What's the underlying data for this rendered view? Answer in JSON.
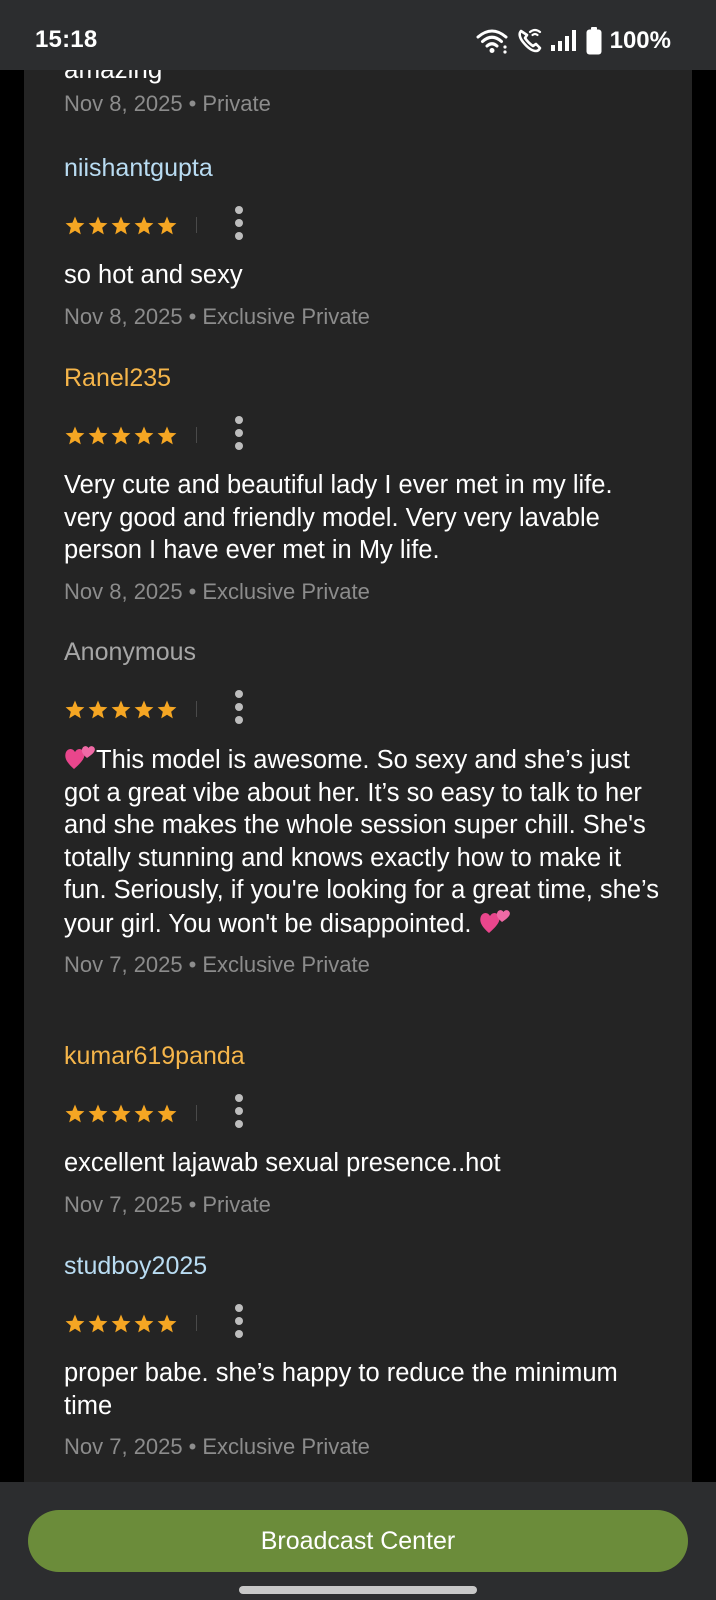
{
  "status_bar": {
    "time": "15:18",
    "battery": "100%"
  },
  "partial_text": "amazing",
  "partial_meta": {
    "date": "Nov 8, 2025",
    "session": "Private"
  },
  "reviews": [
    {
      "username": "niishantgupta",
      "username_color": "#b9dcf2",
      "stars": 5,
      "text": "so hot and sexy",
      "date": "Nov 8, 2025",
      "session": "Exclusive Private"
    },
    {
      "username": "Ranel235",
      "username_color": "#f5b54a",
      "stars": 5,
      "text": "Very cute and beautiful lady I ever met in my life. very good and friendly model. Very very lavable person I have ever met in My life.",
      "date": "Nov 8, 2025",
      "session": "Exclusive Private"
    },
    {
      "username": "Anonymous",
      "username_color": "#a6a6a6",
      "stars": 5,
      "text": "This model is awesome. So sexy and she’s just got a great vibe about her. It’s so easy to talk to her and she makes the whole session super chill. She's totally stunning and knows exactly how to make it fun. Seriously, if you're looking for a great time, she’s your girl. You won't be disappointed.",
      "emoji": "two-hearts-icon",
      "date": "Nov 7, 2025",
      "session": "Exclusive Private"
    },
    {
      "username": "kumar619panda",
      "username_color": "#f5b54a",
      "stars": 5,
      "text": "excellent lajawab sexual presence..hot",
      "date": "Nov 7, 2025",
      "session": "Private"
    },
    {
      "username": "studboy2025",
      "username_color": "#b9dcf2",
      "stars": 5,
      "text": "proper babe. she’s happy to reduce the minimum time",
      "date": "Nov 7, 2025",
      "session": "Exclusive Private"
    }
  ],
  "separator": "•",
  "broadcast_button": "Broadcast Center",
  "colors": {
    "panel": "#242424",
    "star": "#f5a623",
    "button": "#6b8c3a"
  }
}
